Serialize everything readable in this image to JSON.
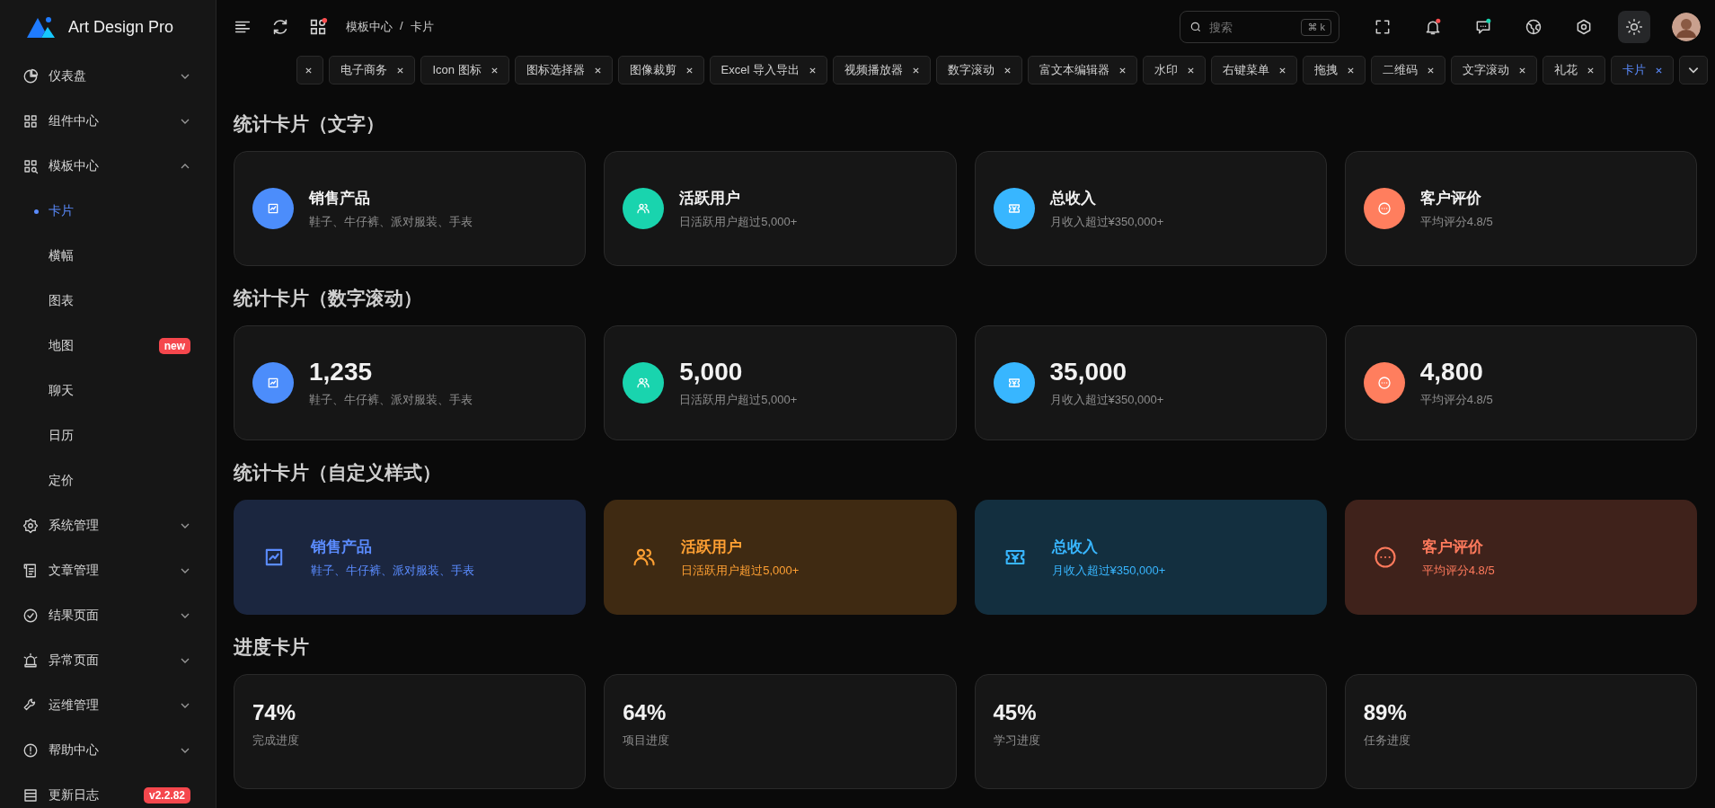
{
  "sidebar": {
    "logo": "Art Design Pro",
    "items": [
      {
        "label": "仪表盘",
        "expanded": false
      },
      {
        "label": "组件中心",
        "expanded": false
      },
      {
        "label": "模板中心",
        "expanded": true,
        "children": [
          {
            "label": "卡片",
            "selected": true
          },
          {
            "label": "横幅",
            "selected": false
          },
          {
            "label": "图表",
            "selected": false
          },
          {
            "label": "地图",
            "selected": false,
            "badge": "new"
          },
          {
            "label": "聊天",
            "selected": false
          },
          {
            "label": "日历",
            "selected": false
          },
          {
            "label": "定价",
            "selected": false
          }
        ]
      },
      {
        "label": "系统管理",
        "expanded": false
      },
      {
        "label": "文章管理",
        "expanded": false
      },
      {
        "label": "结果页面",
        "expanded": false
      },
      {
        "label": "异常页面",
        "expanded": false
      },
      {
        "label": "运维管理",
        "expanded": false
      },
      {
        "label": "帮助中心",
        "expanded": false
      },
      {
        "label": "更新日志",
        "badge": "v2.2.82"
      }
    ]
  },
  "header": {
    "tools": [
      {
        "kind": "menu"
      },
      {
        "kind": "refresh"
      },
      {
        "kind": "apps",
        "color": "#ff4d4f"
      }
    ],
    "breadcrumb": [
      "模板中心",
      "卡片"
    ],
    "breadcrumb_separator": "/",
    "search": {
      "placeholder": "搜索",
      "shortcut": "⌘ k"
    },
    "actions": [
      {
        "kind": "fullscreen"
      },
      {
        "kind": "bell",
        "color": "#ff4d4f"
      },
      {
        "kind": "chat",
        "color": "#19d4ae"
      },
      {
        "kind": "globe"
      },
      {
        "kind": "settings"
      },
      {
        "kind": "theme",
        "selected": true
      },
      {
        "kind": "avatar"
      }
    ]
  },
  "tabs": [
    {
      "selected": false
    },
    {
      "label": "电子商务",
      "selected": false
    },
    {
      "label": "Icon 图标",
      "selected": false
    },
    {
      "label": "图标选择器",
      "selected": false
    },
    {
      "label": "图像裁剪",
      "selected": false
    },
    {
      "label": "Excel 导入导出",
      "selected": false
    },
    {
      "label": "视频播放器",
      "selected": false
    },
    {
      "label": "数字滚动",
      "selected": false
    },
    {
      "label": "富文本编辑器",
      "selected": false
    },
    {
      "label": "水印",
      "selected": false
    },
    {
      "label": "右键菜单",
      "selected": false
    },
    {
      "label": "拖拽",
      "selected": false
    },
    {
      "label": "二维码",
      "selected": false
    },
    {
      "label": "文字滚动",
      "selected": false
    },
    {
      "label": "礼花",
      "selected": false
    },
    {
      "label": "卡片",
      "selected": true
    }
  ],
  "sections": [
    {
      "title": "统计卡片（文字）",
      "kind": "text",
      "cards": [
        {
          "title": "销售产品",
          "desc": "鞋子、牛仔裤、派对服装、手表",
          "color": "#4c8dfb"
        },
        {
          "title": "活跃用户",
          "desc": "日活跃用户超过5,000+",
          "color": "#19d4ae"
        },
        {
          "title": "总收入",
          "desc": "月收入超过¥350,000+",
          "color": "#38b6ff"
        },
        {
          "title": "客户评价",
          "desc": "平均评分4.8/5",
          "color": "#ff7e5e"
        }
      ]
    },
    {
      "title": "统计卡片（数字滚动）",
      "kind": "number",
      "cards": [
        {
          "title": "1,235",
          "desc": "鞋子、牛仔裤、派对服装、手表",
          "color": "#4c8dfb"
        },
        {
          "title": "5,000",
          "desc": "日活跃用户超过5,000+",
          "color": "#19d4ae"
        },
        {
          "title": "35,000",
          "desc": "月收入超过¥350,000+",
          "color": "#38b6ff"
        },
        {
          "title": "4,800",
          "desc": "平均评分4.8/5",
          "color": "#ff7e5e"
        }
      ]
    },
    {
      "title": "统计卡片（自定义样式）",
      "kind": "custom",
      "cards": [
        {
          "title": "销售产品",
          "desc": "鞋子、牛仔裤、派对服装、手表",
          "color": "#5b8cff"
        },
        {
          "title": "活跃用户",
          "desc": "日活跃用户超过5,000+",
          "color": "#ffa033"
        },
        {
          "title": "总收入",
          "desc": "月收入超过¥350,000+",
          "color": "#38b6ff"
        },
        {
          "title": "客户评价",
          "desc": "平均评分4.8/5",
          "color": "#ff7a5c"
        }
      ]
    },
    {
      "title": "进度卡片",
      "kind": "progress",
      "cards": [
        {
          "title": "74%",
          "desc": "完成进度"
        },
        {
          "title": "64%",
          "desc": "项目进度"
        },
        {
          "title": "45%",
          "desc": "学习进度"
        },
        {
          "title": "89%",
          "desc": "任务进度"
        }
      ]
    }
  ]
}
